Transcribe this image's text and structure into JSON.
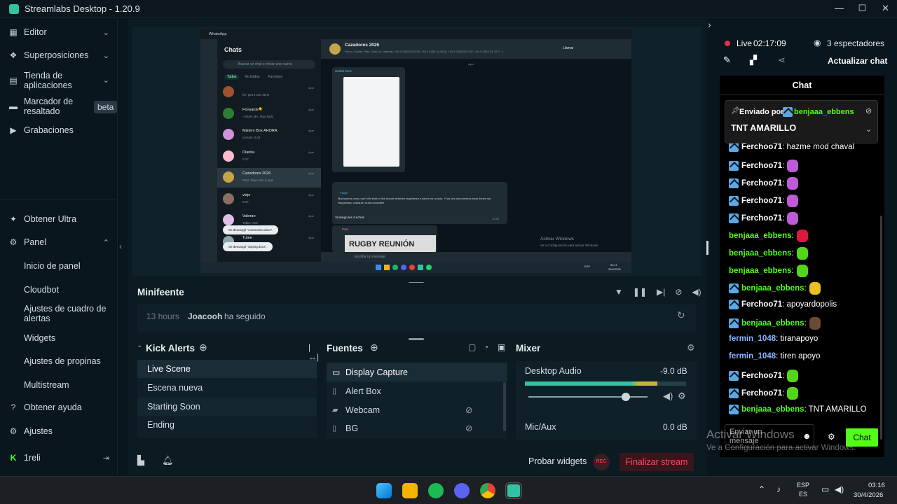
{
  "window": {
    "title": "Streamlabs Desktop - 1.20.9",
    "minimize": "—",
    "maximize": "☐",
    "close": "✕"
  },
  "sidebar": {
    "top_items": [
      {
        "label": "Editor"
      },
      {
        "label": "Superposiciones"
      },
      {
        "label": "Tienda de aplicaciones"
      },
      {
        "label": "Marcador de resaltado",
        "badge": "beta"
      },
      {
        "label": "Grabaciones"
      }
    ],
    "bottom": {
      "ultra": "Obtener Ultra",
      "panel": "Panel",
      "panel_children": [
        "Inicio de panel",
        "Cloudbot",
        "Ajustes de cuadro de alertas",
        "Widgets",
        "Ajustes de propinas",
        "Multistream"
      ],
      "help": "Obtener ayuda",
      "settings": "Ajustes",
      "user": "1reli"
    }
  },
  "preview": {
    "app_title": "WhatsApp",
    "chats_title": "Chats",
    "search_placeholder": "Buscar un chat o iniciar uno nuevo",
    "filters": [
      "Todos",
      "No leídos",
      "Favoritos"
    ],
    "chat_list": [
      {
        "name": "",
        "preview": "fer: perro orto tiene",
        "time": "Ayer"
      },
      {
        "name": "Forwards👇",
        "preview": "~JUAN MA: Muy lindo",
        "time": "Ayer"
      },
      {
        "name": "Mistery Box AHORA",
        "preview": "schumi: 0:04",
        "time": "Ayer"
      },
      {
        "name": "Dianita",
        "preview": "0:17",
        "time": "Ayer"
      },
      {
        "name": "Cazadores 2026",
        "preview": "Pato: Dejo esto a aqui",
        "time": "Ayer"
      },
      {
        "name": "viejo",
        "preview": "0:07",
        "time": "Ayer"
      },
      {
        "name": "Valoran",
        "preview": "Tobia: 0:02",
        "time": "Ayer"
      },
      {
        "name": "Tutee",
        "preview": "",
        "time": "Ayer"
      }
    ],
    "toasts": [
      "Se descargó \"conmocion.docx\".",
      "Se descargó \"doping.docx\"."
    ],
    "group_name": "Cazadores 2026",
    "group_members": "Florvo, Gadiel, Pato, Tomi, vri, Valentin, +54 9 2983 53-3190, +54 9 2983 44-9445, +54 9 2983 58-2297, +54 9 2983 34-7077, +...",
    "call_label": "Llamar",
    "day_label": "Ayer",
    "sender1": "Gadiel kees",
    "quoted": "~ Felipe",
    "long_msg": "Muchachos como van? Ahi está el link donde deberán registrarse y hacer los cursos. Y los dos documentos esos tienen las respuestas, cualquier duda consulten",
    "reply": "Ya tengo los 4 echos",
    "reply_time": "12:45",
    "sender2": "Pato",
    "image_text": "RUGBY REUNIÓN",
    "compose_placeholder": "Escribe un mensaje",
    "activate_title": "Activar Windows",
    "activate_sub": "Ve a Configuración para activar Windows.",
    "inner_taskbar_lang": "ESP",
    "inner_taskbar_time": "03:11",
    "inner_taskbar_date": "30/4/2026"
  },
  "minifeed": {
    "title": "Minifeente",
    "event_time": "13 hours",
    "event_user": "Joacooh",
    "event_action": "ha seguido"
  },
  "scenes": {
    "title": "Kick Alerts",
    "items": [
      "Live Scene",
      "Escena nueva",
      "Starting Soon",
      "Ending"
    ]
  },
  "sources": {
    "title": "Fuentes",
    "items": [
      "Display Capture",
      "Alert Box",
      "Webcam",
      "BG"
    ]
  },
  "mixer": {
    "title": "Mixer",
    "channels": [
      {
        "name": "Desktop Audio",
        "db": "-9.0 dB",
        "level": 0.82
      },
      {
        "name": "Mic/Aux",
        "db": "0.0 dB",
        "level": 0
      }
    ]
  },
  "footer": {
    "test_widgets": "Probar widgets",
    "rec": "REC",
    "end_stream": "Finalizar stream"
  },
  "live": {
    "status": "Live",
    "timer": "02:17:09",
    "viewers": "3 espectadores",
    "refresh_chat": "Actualizar chat"
  },
  "chat": {
    "title": "Chat",
    "pinned_by_label": "Enviado por",
    "pinned_user": "benjaaa_ebbens",
    "pinned_text": "TNT AMARILLO",
    "messages": [
      {
        "user": "Ferchoo71",
        "text": ": hazme mod chaval",
        "kick": true,
        "ucolor": "#ffffff"
      },
      {
        "user": "Ferchoo71",
        "text": ":",
        "kick": true,
        "ucolor": "#ffffff",
        "emote": "#c05bd8"
      },
      {
        "user": "Ferchoo71",
        "text": ":",
        "kick": true,
        "ucolor": "#ffffff",
        "emote": "#c05bd8"
      },
      {
        "user": "Ferchoo71",
        "text": ":",
        "kick": true,
        "ucolor": "#ffffff",
        "emote": "#c05bd8"
      },
      {
        "user": "Ferchoo71",
        "text": ":",
        "kick": true,
        "ucolor": "#ffffff",
        "emote": "#c05bd8"
      },
      {
        "user": "benjaaa_ebbens",
        "text": ":",
        "kick": false,
        "ucolor": "#53fc18",
        "emote": "#e0183c"
      },
      {
        "user": "benjaaa_ebbens",
        "text": ":",
        "kick": false,
        "ucolor": "#53fc18",
        "emote": "#53d61a"
      },
      {
        "user": "benjaaa_ebbens",
        "text": ":",
        "kick": false,
        "ucolor": "#53fc18",
        "emote": "#53d61a"
      },
      {
        "user": "benjaaa_ebbens",
        "text": ":",
        "kick": true,
        "ucolor": "#53fc18",
        "emote": "#e8c020"
      },
      {
        "user": "Ferchoo71",
        "text": ": apoyardopolis",
        "kick": true,
        "ucolor": "#ffffff"
      },
      {
        "user": "benjaaa_ebbens",
        "text": ":",
        "kick": true,
        "ucolor": "#53fc18",
        "emote": "#6b4a36"
      },
      {
        "user": "fermin_1048",
        "text": ": tiranapoyo",
        "kick": false,
        "ucolor": "#8ab4ff"
      },
      {
        "user": "fermin_1048",
        "text": ": tiren apoyo",
        "kick": false,
        "ucolor": "#8ab4ff"
      },
      {
        "user": "Ferchoo71",
        "text": ":",
        "kick": true,
        "ucolor": "#ffffff",
        "emote": "#53d61a"
      },
      {
        "user": "Ferchoo71",
        "text": ":",
        "kick": true,
        "ucolor": "#ffffff",
        "emote": "#53d61a"
      },
      {
        "user": "benjaaa_ebbens",
        "text": ": TNT AMARILLO",
        "kick": true,
        "ucolor": "#53fc18"
      }
    ],
    "input_placeholder": "Enviar un mensaje",
    "send_label": "Chat"
  },
  "watermark": {
    "title": "Activar Windows",
    "sub": "Ve a Configuración para activar Windows."
  },
  "taskbar": {
    "lang_top": "ESP",
    "lang_bottom": "ES",
    "time": "03:16",
    "date": "30/4/2026"
  }
}
